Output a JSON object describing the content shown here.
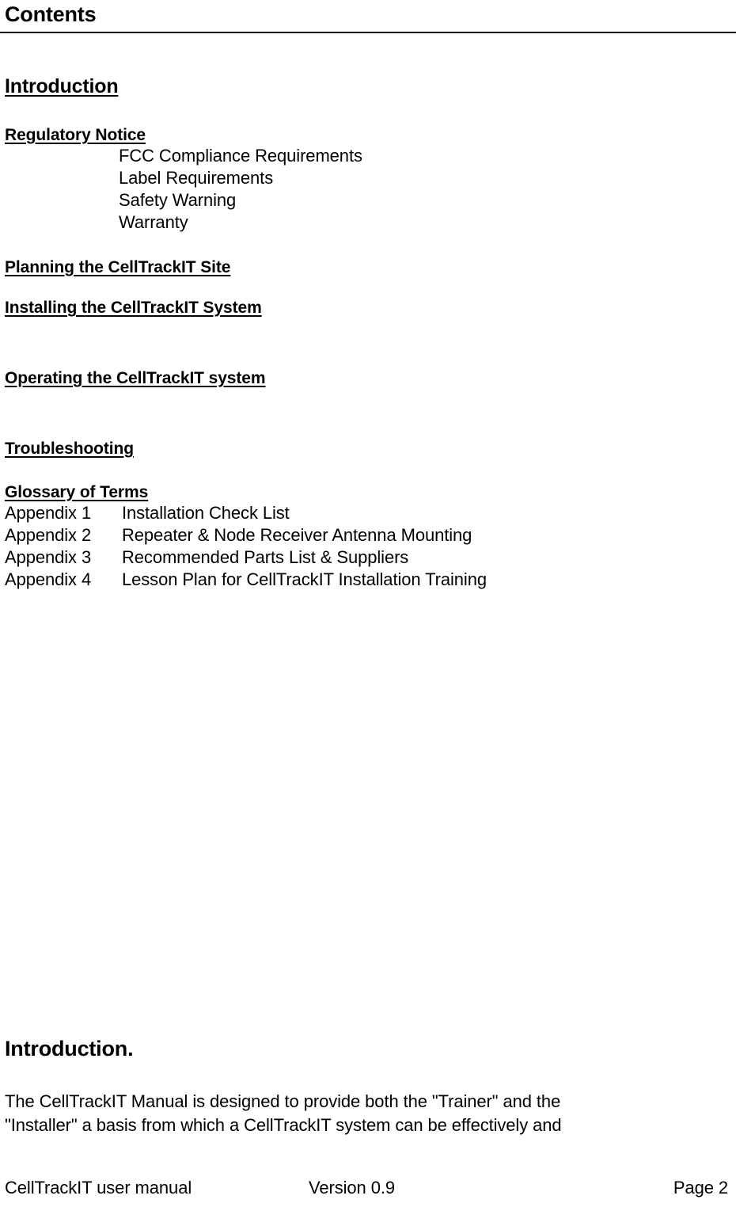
{
  "header": {
    "title": "Contents",
    "rule_color": "#000000"
  },
  "toc": {
    "introduction_heading": "Introduction",
    "regulatory": {
      "heading": "Regulatory Notice",
      "items": [
        "FCC Compliance Requirements",
        "Label Requirements",
        "Safety Warning",
        "Warranty"
      ]
    },
    "sections": [
      "Planning the CellTrackIT Site",
      "Installing the CellTrackIT System",
      "Operating the CellTrackIT system",
      "Troubleshooting",
      "Glossary of Terms"
    ],
    "appendices": [
      {
        "number": "Appendix 1",
        "title": "Installation Check List"
      },
      {
        "number": "Appendix 2",
        "title": "Repeater & Node Receiver Antenna Mounting"
      },
      {
        "number": "Appendix 3",
        "title": "Recommended Parts List & Suppliers"
      },
      {
        "number": "Appendix 4",
        "title": "Lesson Plan for CellTrackIT Installation Training"
      }
    ]
  },
  "introduction": {
    "heading": "Introduction.",
    "paragraph_lines": [
      "The CellTrackIT Manual is designed to provide both the \"Trainer\" and the",
      "\"Installer\" a basis from which a CellTrackIT system can be effectively and"
    ]
  },
  "footer": {
    "left": "CellTrackIT user manual",
    "center": "Version 0.9",
    "right": "Page 2"
  }
}
